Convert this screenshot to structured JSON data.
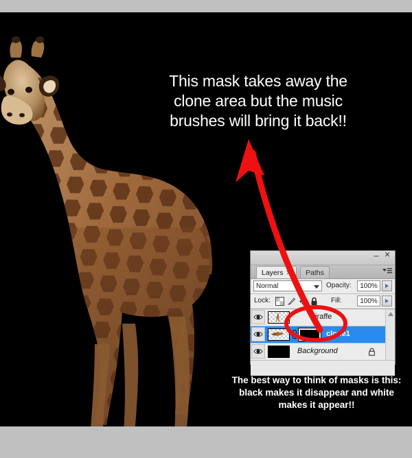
{
  "image": {
    "background_color": "#000000",
    "band_color": "#c0c0c0",
    "subject": "giraffe-photo"
  },
  "annotations": {
    "arrow_color": "#ee1111",
    "ellipse_color": "#ee1111",
    "top_caption": {
      "line1": "This mask takes away the",
      "line2": "clone area but the music",
      "line3": "brushes will bring it back!!",
      "color": "#ffffff"
    },
    "bottom_caption": {
      "line1": "The best way to think of masks is this:",
      "line2": "black makes it disappear and white",
      "line3": "makes it appear!!",
      "color": "#ffffff"
    }
  },
  "layers_panel": {
    "window": {
      "minimize_label": "–",
      "close_label": "✕",
      "menu_icon": "panel-menu-icon"
    },
    "tabs": [
      {
        "label": "Layers",
        "active": true,
        "closable": true,
        "close_glyph": "✕"
      },
      {
        "label": "Paths",
        "active": false,
        "closable": false
      }
    ],
    "blend": {
      "mode_value": "Normal",
      "opacity_label": "Opacity:",
      "opacity_value": "100%"
    },
    "lock": {
      "label": "Lock:",
      "icons": [
        "lock-transparent-pixels-icon",
        "lock-image-pixels-icon",
        "lock-position-icon",
        "lock-all-icon"
      ],
      "fill_label": "Fill:",
      "fill_value": "100%"
    },
    "layers": [
      {
        "name": "giraffe",
        "visible": true,
        "selected": false,
        "thumbnail": "giraffe-transparent-thumb",
        "has_mask": false,
        "locked": false,
        "italic": false
      },
      {
        "name": "clone1",
        "visible": true,
        "selected": true,
        "thumbnail": "clone-transparent-thumb",
        "has_mask": true,
        "mask_thumbnail": "black-mask-thumb",
        "linked": true,
        "locked": false,
        "italic": false
      },
      {
        "name": "Background",
        "visible": true,
        "selected": false,
        "thumbnail": "black-solid-thumb",
        "has_mask": false,
        "locked": true,
        "italic": true
      }
    ],
    "selection_color": "#2a8bef"
  }
}
